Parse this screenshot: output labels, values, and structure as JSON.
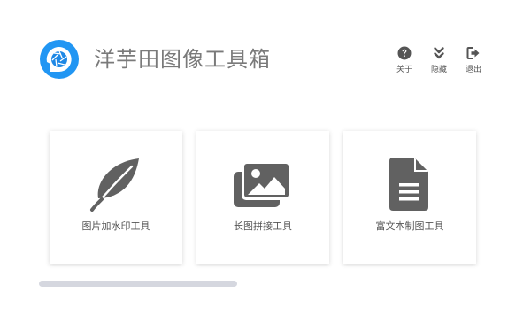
{
  "header": {
    "title": "洋芋田图像工具箱",
    "logo_icon": "aperture-logo-icon",
    "brand_color": "#2196f3"
  },
  "toolbar": {
    "about_label": "关于",
    "about_icon": "question-circle-icon",
    "hide_label": "隐藏",
    "hide_icon": "double-chevron-down-icon",
    "exit_label": "退出",
    "exit_icon": "sign-out-icon"
  },
  "tools": [
    {
      "label": "图片加水印工具",
      "icon": "feather-icon"
    },
    {
      "label": "长图拼接工具",
      "icon": "images-stack-icon"
    },
    {
      "label": "富文本制图工具",
      "icon": "document-icon"
    }
  ],
  "colors": {
    "icon": "#616161",
    "title_text": "#7a7a7a",
    "scrollbar": "#d5d7df"
  }
}
